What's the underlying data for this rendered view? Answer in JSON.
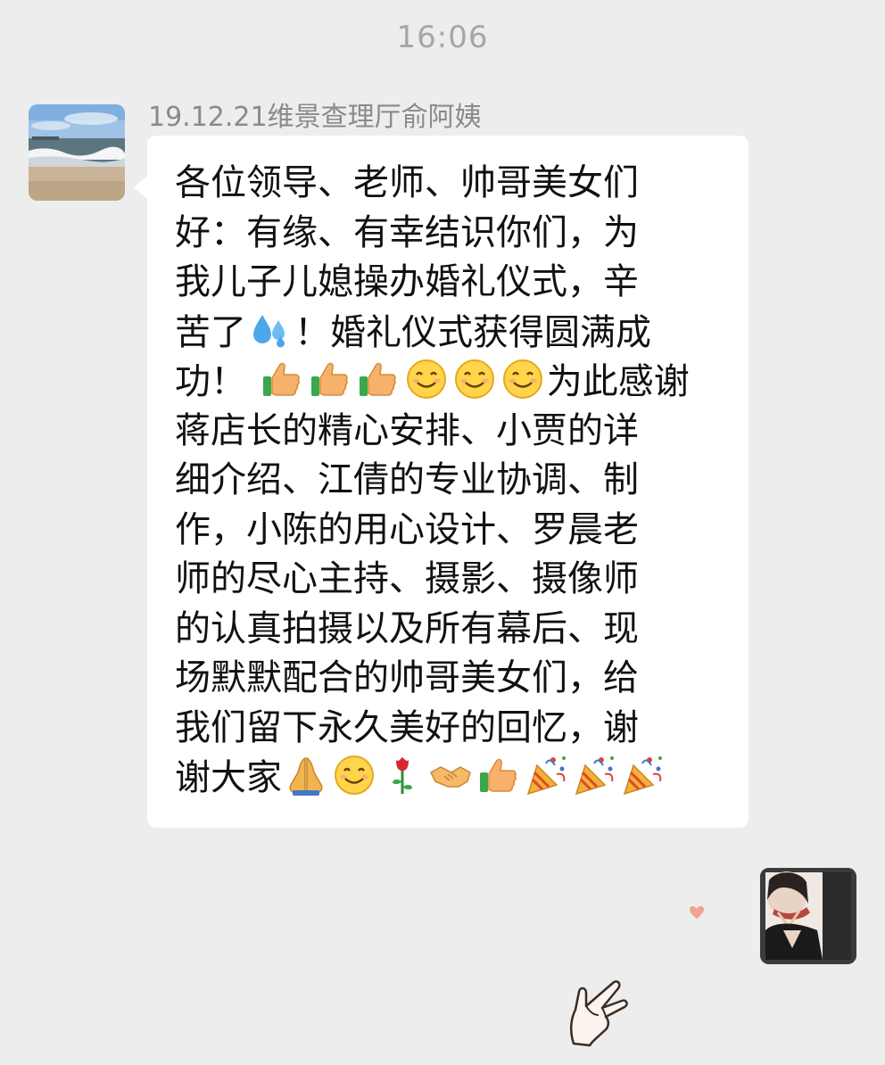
{
  "timestamp": "16:06",
  "sender": {
    "name": "19.12.21维景查理厅俞阿姨",
    "avatar_icon": "seaside-photo-avatar"
  },
  "message": {
    "lines": [
      "各位领导、老师、帅哥美女们",
      "好：有缘、有幸结识你们，为",
      "我儿子儿媳操办婚礼仪式，辛",
      "苦了",
      "！婚礼仪式获得圆满成",
      "功！",
      "为此感谢",
      "蒋店长的精心安排、小贾的详",
      "细介绍、江倩的专业协调、制",
      "作，小陈的用心设计、罗晨老",
      "师的尽心主持、摄影、摄像师",
      "的认真拍摄以及所有幕后、现",
      "场默默配合的帅哥美女们，给",
      "我们留下永久美好的回忆，谢",
      "谢大家"
    ],
    "emoji": {
      "sweat": "sweat-droplets-icon",
      "thumbs_up": "thumbs-up-icon",
      "smile": "smile-icon",
      "pray": "folded-hands-icon",
      "rose": "rose-icon",
      "handshake": "handshake-icon",
      "party": "party-popper-icon"
    }
  },
  "self": {
    "avatar_icon": "portrait-photo-avatar"
  },
  "decorations": {
    "heart": "small-heart-icon",
    "hand": "pointing-hand-icon"
  },
  "colors": {
    "background": "#ededed",
    "bubble": "#ffffff",
    "timestamp_text": "#a6a6a6",
    "sender_text": "#8a8a8a",
    "message_text": "#111111"
  }
}
